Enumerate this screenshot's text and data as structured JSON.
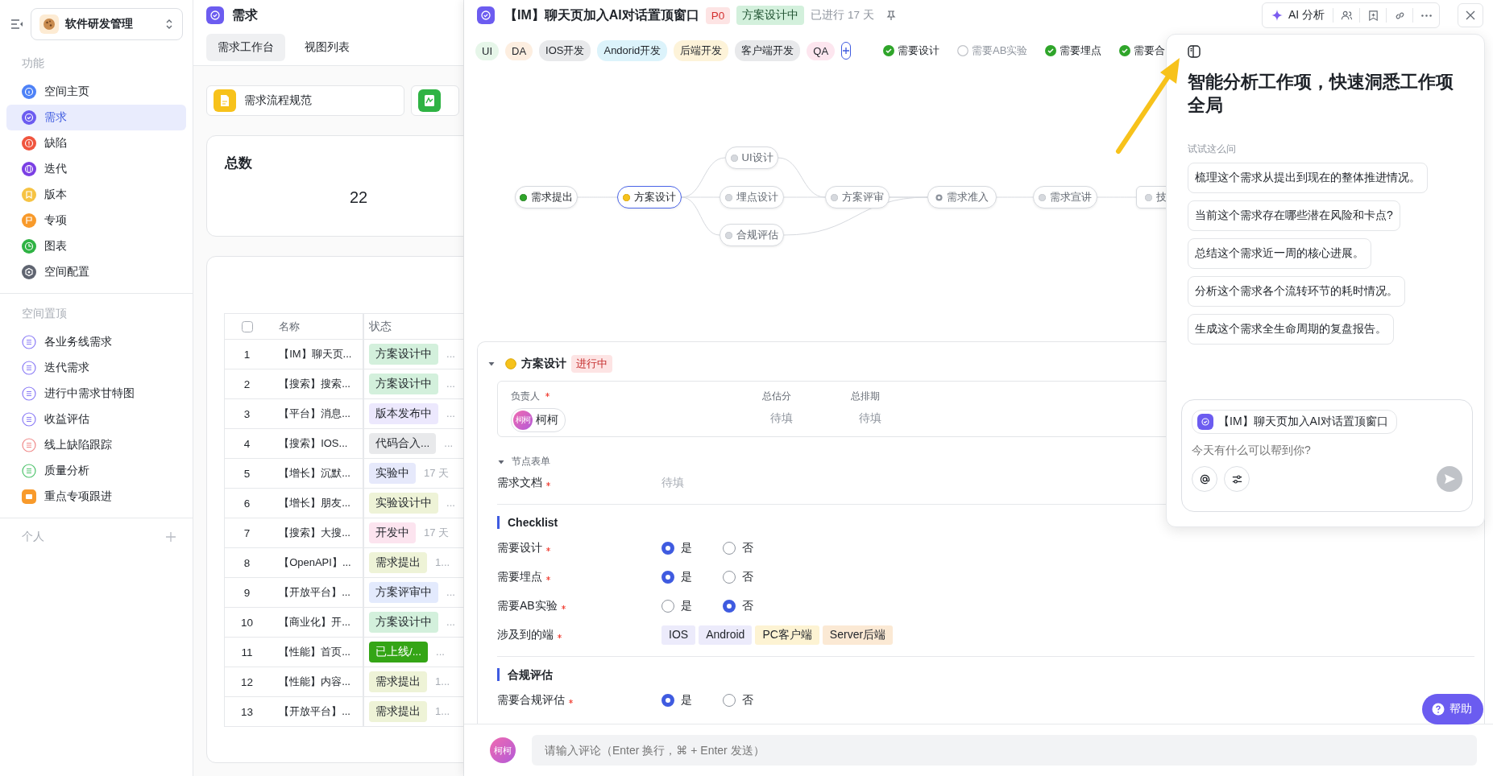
{
  "sidebar": {
    "workspace": "软件研发管理",
    "sections": [
      {
        "title": "功能",
        "items": [
          {
            "label": "空间主页",
            "kind": "info",
            "color": "#4e82f7",
            "selected": false
          },
          {
            "label": "需求",
            "kind": "check",
            "color": "#6c5cf0",
            "selected": true
          },
          {
            "label": "缺陷",
            "kind": "alert",
            "color": "#f0553f",
            "selected": false
          },
          {
            "label": "迭代",
            "kind": "orbit",
            "color": "#7b3fe4",
            "selected": false
          },
          {
            "label": "版本",
            "kind": "bookmark",
            "color": "#f6c343",
            "selected": false
          },
          {
            "label": "专项",
            "kind": "flag",
            "color": "#f89a2b",
            "selected": false
          },
          {
            "label": "图表",
            "kind": "chart",
            "color": "#2fb344",
            "selected": false
          },
          {
            "label": "空间配置",
            "kind": "gear",
            "color": "#5f6470",
            "selected": false
          }
        ]
      },
      {
        "title": "空间置顶",
        "items": [
          {
            "label": "各业务线需求",
            "kind": "list",
            "color": "#8b7cf6",
            "selected": false
          },
          {
            "label": "迭代需求",
            "kind": "list",
            "color": "#8b7cf6",
            "selected": false
          },
          {
            "label": "进行中需求甘特图",
            "kind": "list",
            "color": "#8b7cf6",
            "selected": false
          },
          {
            "label": "收益评估",
            "kind": "list",
            "color": "#8b7cf6",
            "selected": false
          },
          {
            "label": "线上缺陷跟踪",
            "kind": "list",
            "color": "#f08a8a",
            "selected": false
          },
          {
            "label": "质量分析",
            "kind": "list",
            "color": "#4cc26a",
            "selected": false
          },
          {
            "label": "重点专项跟进",
            "kind": "folder",
            "color": "#f89a2b",
            "selected": false
          }
        ]
      }
    ],
    "personal": {
      "title": "个人"
    }
  },
  "middle": {
    "title": "需求",
    "tabs": [
      {
        "label": "需求工作台",
        "selected": true
      },
      {
        "label": "视图列表",
        "selected": false
      }
    ],
    "shortcuts": [
      {
        "label": "需求流程规范",
        "kind": "doc"
      },
      {
        "kind": "sign"
      }
    ],
    "stat": {
      "title": "总数",
      "value": "22"
    },
    "table": {
      "all_checked": false,
      "columns": [
        "名称",
        "状态"
      ],
      "rows": [
        {
          "index": "1",
          "name": "【IM】聊天页...",
          "status": "方案设计中",
          "color": "#d3f0dc",
          "extra": "..."
        },
        {
          "index": "2",
          "name": "【搜索】搜索...",
          "status": "方案设计中",
          "color": "#d3f0dc",
          "extra": "..."
        },
        {
          "index": "3",
          "name": "【平台】消息...",
          "status": "版本发布中",
          "color": "#ece8fd",
          "extra": "..."
        },
        {
          "index": "4",
          "name": "【搜索】IOS...",
          "status": "代码合入...",
          "color": "#e8e9eb",
          "extra": "..."
        },
        {
          "index": "5",
          "name": "【增长】沉默...",
          "status": "实验中",
          "color": "#e6e9fb",
          "extra": "17 天"
        },
        {
          "index": "6",
          "name": "【增长】朋友...",
          "status": "实验设计中",
          "color": "#eef3d7",
          "extra": "..."
        },
        {
          "index": "7",
          "name": "【搜索】大搜...",
          "status": "开发中",
          "color": "#fce4ef",
          "extra": "17 天"
        },
        {
          "index": "8",
          "name": "【OpenAPI】...",
          "status": "需求提出",
          "color": "#eef3d7",
          "extra": "1..."
        },
        {
          "index": "9",
          "name": "【开放平台】...",
          "status": "方案评审中",
          "color": "#e3eafd",
          "extra": "..."
        },
        {
          "index": "10",
          "name": "【商业化】开...",
          "status": "方案设计中",
          "color": "#d3f0dc",
          "extra": "..."
        },
        {
          "index": "11",
          "name": "【性能】首页...",
          "status": "已上线/...",
          "color": "#34a516",
          "extra": "..."
        },
        {
          "index": "12",
          "name": "【性能】内容...",
          "status": "需求提出",
          "color": "#eef3d7",
          "extra": "1..."
        },
        {
          "index": "13",
          "name": "【开放平台】...",
          "status": "需求提出",
          "color": "#eef3d7",
          "extra": "1..."
        }
      ]
    }
  },
  "detail": {
    "title": "【IM】聊天页加入AI对话置顶窗口",
    "priority": "P0",
    "status": "方案设计中",
    "elapsed": "已进行 17 天",
    "ai_button": "AI 分析",
    "tags": [
      {
        "label": "UI",
        "color": "#e6f6e9"
      },
      {
        "label": "DA",
        "color": "#fdeee0"
      },
      {
        "label": "IOS开发",
        "color": "#e8e9eb"
      },
      {
        "label": "Andorid开发",
        "color": "#dcf3fb"
      },
      {
        "label": "后端开发",
        "color": "#fdf3d9"
      },
      {
        "label": "客户端开发",
        "color": "#e8e9eb"
      },
      {
        "label": "QA",
        "color": "#fde6ef"
      }
    ],
    "flags": [
      {
        "label": "需要设计",
        "checked": true
      },
      {
        "label": "需要AB实验",
        "checked": false
      },
      {
        "label": "需要埋点",
        "checked": true
      },
      {
        "label": "需要合",
        "checked": true
      }
    ],
    "flow": [
      {
        "label": "需求提出",
        "kind": "done"
      },
      {
        "label": "方案设计",
        "kind": "current"
      },
      {
        "label": "UI设计",
        "kind": "pending"
      },
      {
        "label": "埋点设计",
        "kind": "pending"
      },
      {
        "label": "合规评估",
        "kind": "pending"
      },
      {
        "label": "方案评审",
        "kind": "pending"
      },
      {
        "label": "需求准入",
        "kind": "gate"
      },
      {
        "label": "需求宣讲",
        "kind": "pending"
      },
      {
        "label": "技",
        "kind": "pending"
      }
    ],
    "stage": {
      "name": "方案设计",
      "state": "进行中",
      "expanded": true,
      "fields": [
        {
          "label": "负责人",
          "required": true,
          "kind": "person",
          "avatar": "柯柯",
          "value": "柯柯"
        },
        {
          "label": "总估分",
          "required": false,
          "kind": "text",
          "placeholder": "待填"
        },
        {
          "label": "总排期",
          "required": false,
          "kind": "text",
          "placeholder": "待填"
        }
      ]
    },
    "form": {
      "title": "节点表单",
      "expanded": true,
      "doc": {
        "label": "需求文档",
        "required": true,
        "placeholder": "待填"
      }
    },
    "groups": [
      {
        "title": "Checklist",
        "rows": [
          {
            "label": "需要设计",
            "required": true,
            "kind": "radio",
            "options": [
              {
                "label": "是",
                "selected": true
              },
              {
                "label": "否",
                "selected": false
              }
            ]
          },
          {
            "label": "需要埋点",
            "required": true,
            "kind": "radio",
            "options": [
              {
                "label": "是",
                "selected": true
              },
              {
                "label": "否",
                "selected": false
              }
            ]
          },
          {
            "label": "需要AB实验",
            "required": true,
            "kind": "radio",
            "options": [
              {
                "label": "是",
                "selected": false
              },
              {
                "label": "否",
                "selected": true
              }
            ]
          },
          {
            "label": "涉及到的端",
            "required": true,
            "kind": "tags",
            "tags": [
              {
                "label": "IOS",
                "color": "#ecebfb"
              },
              {
                "label": "Android",
                "color": "#ecebfb"
              },
              {
                "label": "PC客户端",
                "color": "#fdf3d3"
              },
              {
                "label": "Server后端",
                "color": "#fbe9d4"
              }
            ]
          }
        ]
      },
      {
        "title": "合规评估",
        "rows": [
          {
            "label": "需要合规评估",
            "required": true,
            "kind": "radio",
            "options": [
              {
                "label": "是",
                "selected": true
              },
              {
                "label": "否",
                "selected": false
              }
            ]
          }
        ]
      }
    ],
    "comment": {
      "avatar": "柯柯",
      "placeholder": "请输入评论（Enter 换行，⌘ + Enter 发送）"
    },
    "help": "帮助"
  },
  "ai_panel": {
    "title": "智能分析工作项，快速洞悉工作项全局",
    "hint": "试试这么问",
    "suggestions": [
      "梳理这个需求从提出到现在的整体推进情况。",
      "当前这个需求存在哪些潜在风险和卡点?",
      "总结这个需求近一周的核心进展。",
      "分析这个需求各个流转环节的耗时情况。",
      "生成这个需求全生命周期的复盘报告。"
    ],
    "context": "【IM】聊天页加入AI对话置顶窗口",
    "placeholder": "今天有什么可以帮到你?"
  }
}
